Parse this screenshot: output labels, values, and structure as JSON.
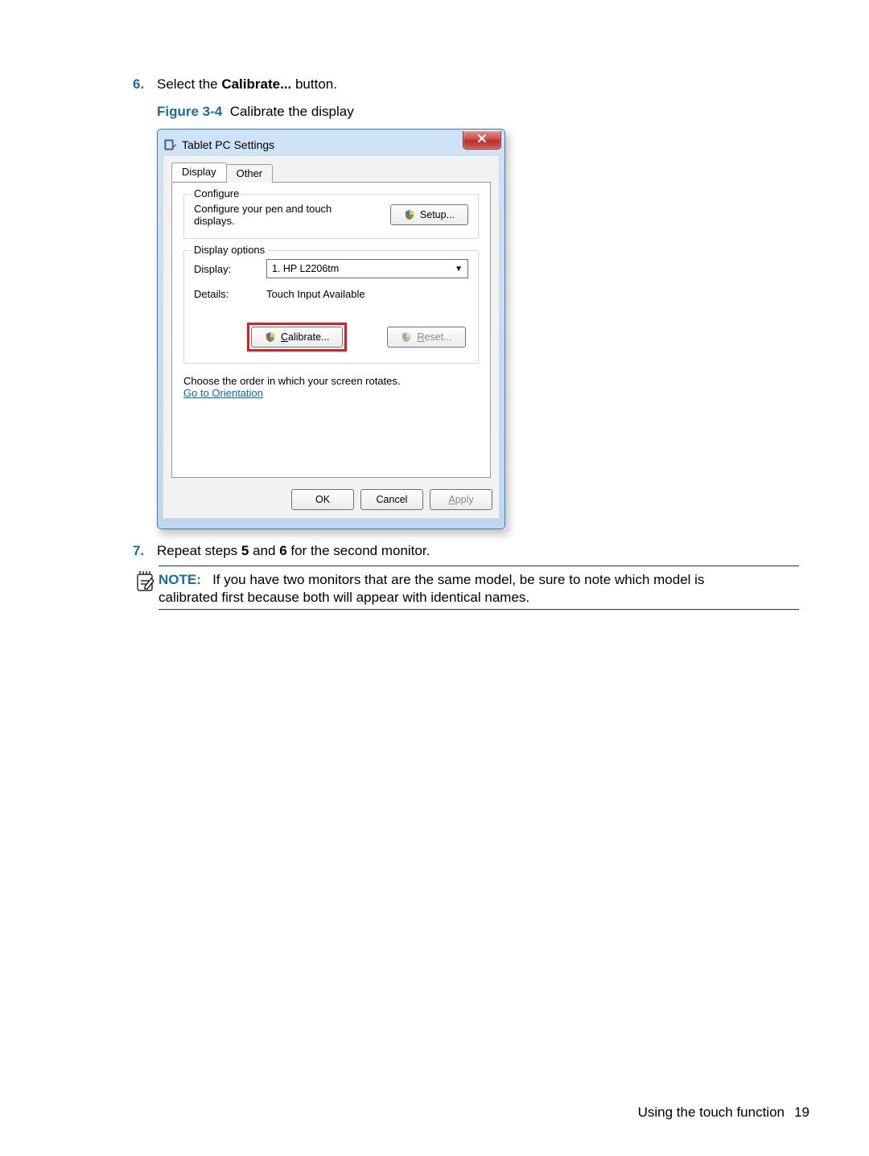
{
  "step6": {
    "num": "6.",
    "prefix": "Select the ",
    "bold": "Calibrate...",
    "suffix": " button."
  },
  "figure": {
    "label": "Figure 3-4",
    "caption": "Calibrate the display"
  },
  "dialog": {
    "title": "Tablet PC Settings",
    "tabs": {
      "display": "Display",
      "other": "Other"
    },
    "configure": {
      "legend": "Configure",
      "text": "Configure your pen and touch displays.",
      "setup_btn": "Setup..."
    },
    "display_options": {
      "legend": "Display options",
      "display_label": "Display:",
      "display_value": "1. HP L2206tm",
      "details_label": "Details:",
      "details_value": "Touch Input Available",
      "calibrate_btn_pre": "C",
      "calibrate_btn_post": "alibrate...",
      "reset_btn_pre": "R",
      "reset_btn_post": "eset..."
    },
    "rotate_text": "Choose the order in which your screen rotates.",
    "orientation_link": "Go to Orientation",
    "ok": "OK",
    "cancel": "Cancel",
    "apply_pre": "A",
    "apply_post": "pply"
  },
  "step7": {
    "num": "7.",
    "p1": "Repeat steps ",
    "b1": "5",
    "p2": " and ",
    "b2": "6",
    "p3": " for the second monitor."
  },
  "note": {
    "label": "NOTE:",
    "text1": "If you have two monitors that are the same model, be sure to note which model is",
    "text2": "calibrated first because both will appear with identical names."
  },
  "footer": {
    "text": "Using the touch function",
    "page": "19"
  }
}
